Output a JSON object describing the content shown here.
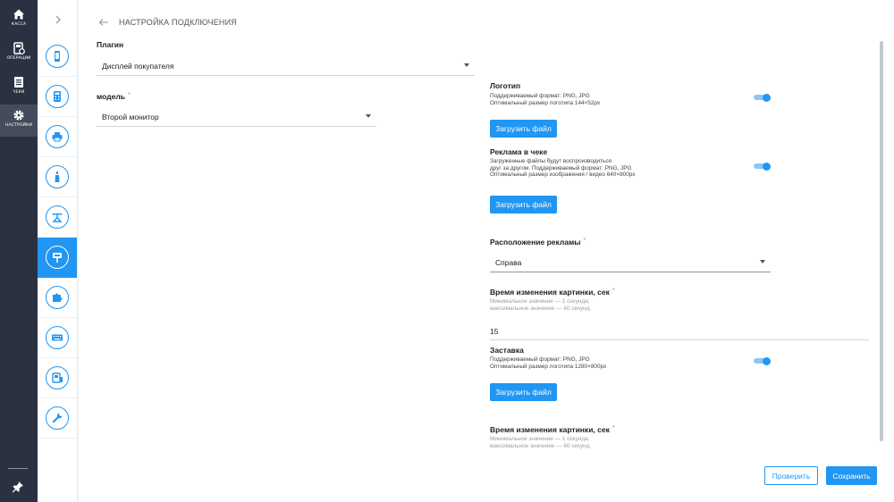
{
  "nav": {
    "items": [
      {
        "label": "КАССА",
        "icon": "home-icon"
      },
      {
        "label": "ОПЕРАЦИИ",
        "icon": "operations-icon"
      },
      {
        "label": "ЧЕКИ",
        "icon": "receipts-icon"
      },
      {
        "label": "НАСТРОЙКИ",
        "icon": "settings-icon"
      }
    ],
    "active": "НАСТРОЙКИ"
  },
  "subnav": {
    "icons": [
      "phone-icon",
      "calculator-icon",
      "printer-icon",
      "bottle-icon",
      "scale-icon",
      "customer-display-icon",
      "puzzle-icon",
      "keyboard-icon",
      "scanner-icon",
      "wrench-icon"
    ],
    "active_index": 5
  },
  "header": {
    "title": "НАСТРОЙКА ПОДКЛЮЧЕНИЯ"
  },
  "left_form": {
    "plugin_label": "Плагин",
    "plugin_value": "Дисплей покупателя",
    "model_label": "модель",
    "model_value": "Второй монитор",
    "required_mark": "*"
  },
  "right_form": {
    "logo": {
      "title": "Логотип",
      "hint": "Поддерживаемый формат: PNG, JPG\nОптимальный размер логотипа 144×52px",
      "toggle_on": true,
      "button": "Загрузить файл"
    },
    "ad": {
      "title": "Реклама в чеке",
      "hint": "Загруженные файлы будут воспроизводиться\nдруг за другом. Поддерживаемый формат: PNG, JPG\nОптимальный размер изображения / видео 640×800px",
      "toggle_on": true,
      "button": "Загрузить файл"
    },
    "ad_position": {
      "label": "Расположение рекламы",
      "value": "Справа"
    },
    "image_change": {
      "label": "Время изменения картинки, сек",
      "hint": "Минимальное значение — 1 секунда;\nмаксимальное значение — 60 секунд.",
      "value": "15"
    },
    "splash": {
      "title": "Заставка",
      "hint": "Поддерживаемый формат: PNG, JPG\nОптимальный размер логотипа 1280×800px",
      "toggle_on": true,
      "button": "Загрузить файл"
    },
    "image_change_2": {
      "label": "Время изменения картинки, сек",
      "hint": "Минимальное значение — 1 секунда;\nмаксимальное значение — 60 секунд."
    }
  },
  "footer": {
    "check_label": "Проверить",
    "save_label": "Сохранить"
  },
  "colors": {
    "accent": "#2196f3",
    "nav_bg": "#2a3140"
  }
}
